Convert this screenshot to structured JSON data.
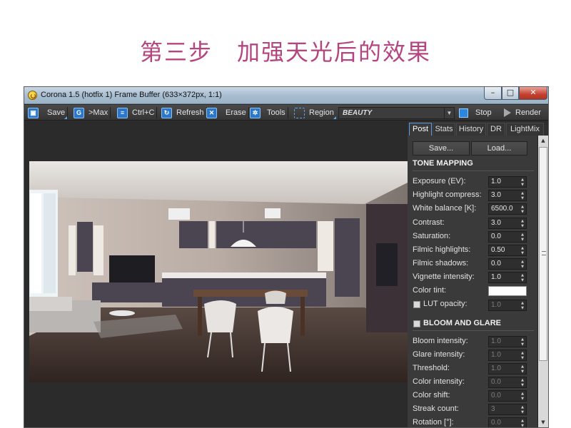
{
  "heading": "第三步　加强天光后的效果",
  "window": {
    "title": "Corona 1.5 (hotfix 1) Frame Buffer (633×372px, 1:1)",
    "controls": {
      "minimize": "–",
      "maximize": "□",
      "close": "✕"
    }
  },
  "toolbar": {
    "save": "Save",
    "max": ">Max",
    "copy": "Ctrl+C",
    "refresh": "Refresh",
    "erase": "Erase",
    "tools": "Tools",
    "region": "Region",
    "pass": "BEAUTY",
    "stop": "Stop",
    "render": "Render"
  },
  "tabs": [
    "Post",
    "Stats",
    "History",
    "DR",
    "LightMix"
  ],
  "active_tab": "Post",
  "panel": {
    "save_button": "Save...",
    "load_button": "Load...",
    "tone_mapping": {
      "title": "TONE MAPPING",
      "rows": [
        {
          "label": "Exposure (EV):",
          "value": "1.0"
        },
        {
          "label": "Highlight compress:",
          "value": "3.0"
        },
        {
          "label": "White balance [K]:",
          "value": "6500.0"
        },
        {
          "label": "Contrast:",
          "value": "3.0"
        },
        {
          "label": "Saturation:",
          "value": "0.0"
        },
        {
          "label": "Filmic highlights:",
          "value": "0.50"
        },
        {
          "label": "Filmic shadows:",
          "value": "0.0"
        },
        {
          "label": "Vignette intensity:",
          "value": "1.0"
        }
      ],
      "color_tint_label": "Color tint:",
      "color_tint": "#ffffff",
      "lut_label": "LUT opacity:",
      "lut_value": "1.0"
    },
    "bloom_glare": {
      "title": "BLOOM AND GLARE",
      "rows": [
        {
          "label": "Bloom intensity:",
          "value": "1.0"
        },
        {
          "label": "Glare intensity:",
          "value": "1.0"
        },
        {
          "label": "Threshold:",
          "value": "1.0"
        },
        {
          "label": "Color intensity:",
          "value": "0.0"
        },
        {
          "label": "Color shift:",
          "value": "0.0"
        },
        {
          "label": "Streak count:",
          "value": "3"
        },
        {
          "label": "Rotation [°]:",
          "value": "0.0"
        }
      ]
    }
  },
  "colors": {
    "heading": "#b5457f",
    "accent": "#2b88e0",
    "panel_bg": "#3a3a3a"
  }
}
